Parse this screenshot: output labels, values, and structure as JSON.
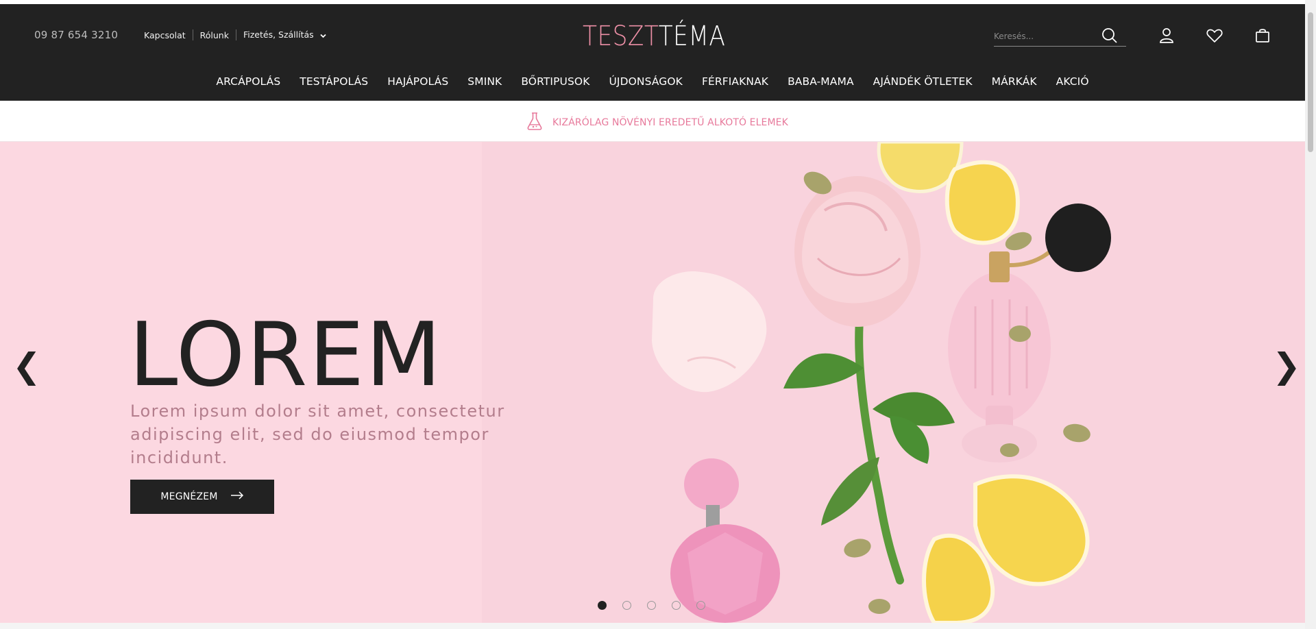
{
  "header": {
    "phone": "09 87 654 3210",
    "links": [
      "Kapcsolat",
      "Rólunk",
      "Fizetés, Szállítás"
    ],
    "logo_part1": "TESZT",
    "logo_part2": "TÉMA",
    "search": {
      "placeholder": "Keresés..."
    },
    "icons": [
      "search-icon",
      "user-icon",
      "heart-icon",
      "bag-icon"
    ]
  },
  "nav": {
    "items": [
      "ARCÁPOLÁS",
      "TESTÁPOLÁS",
      "HAJÁPOLÁS",
      "SMINK",
      "BŐRTIPUSOK",
      "ÚJDONSÁGOK",
      "FÉRFIAKNAK",
      "BABA-MAMA",
      "AJÁNDÉK ÖTLETEK",
      "MÁRKÁK",
      "AKCIÓ"
    ]
  },
  "promo": {
    "text": "KIZÁRÓLAG NÖVÉNYI EREDETŰ ALKOTÓ ELEMEK",
    "icon": "flask-icon"
  },
  "hero": {
    "title": "LOREM",
    "subtitle": "Lorem ipsum dolor sit amet, consectetur adipiscing elit, sed do eiusmod tempor incididunt.",
    "button_label": "MEGNÉZEM",
    "prev_glyph": "❮",
    "next_glyph": "❯",
    "slide_count": 5,
    "active_slide": 1
  },
  "colors": {
    "header_bg": "#222222",
    "accent_pink": "#ec8fa6",
    "hero_bg": "#fbd9e2",
    "promo_text": "#e7799b"
  }
}
